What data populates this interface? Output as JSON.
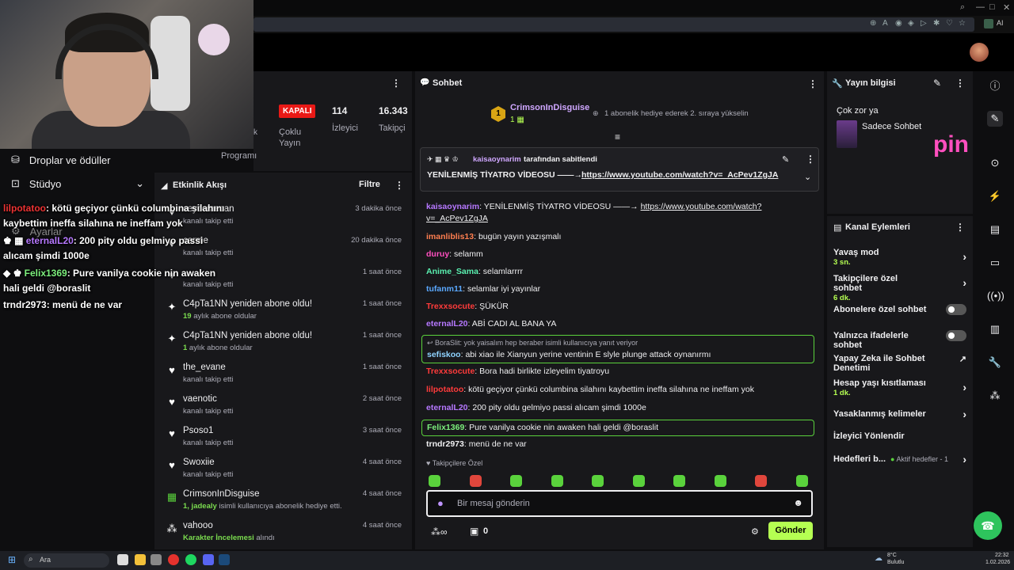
{
  "left_panel": {
    "drops": "Droplar ve ödüller",
    "studio": "Stüdyo",
    "settings": "Ayarlar"
  },
  "stats": {
    "status": "KAPALI",
    "viewers_value": "114",
    "viewers_label": "İzleyici",
    "followers_value": "16.343",
    "followers_label": "Takipçi",
    "multistream": "Çoklu\nYayın",
    "program": "Programı",
    "k": "k"
  },
  "activity": {
    "title": "Etkinlik Akışı",
    "filter": "Filtre",
    "rows": [
      {
        "icon": "heart",
        "name": "ceycemecan",
        "sub": "kanalı takip etti",
        "time": "3 dakika önce"
      },
      {
        "icon": "heart",
        "name": "carme",
        "sub": "kanalı takip etti",
        "time": "20 dakika önce"
      },
      {
        "icon": "heart",
        "name": "",
        "sub": "kanalı takip etti",
        "time": "1 saat önce"
      },
      {
        "icon": "sparkle",
        "name": "C4pTa1NN yeniden abone oldu!",
        "sub_g": "19",
        "sub": " aylık abone oldular",
        "time": "1 saat önce"
      },
      {
        "icon": "sparkle",
        "name": "C4pTa1NN yeniden abone oldu!",
        "sub_g": "1",
        "sub": " aylık abone oldular",
        "time": "1 saat önce"
      },
      {
        "icon": "heart",
        "name": "the_evane",
        "sub": "kanalı takip etti",
        "time": "1 saat önce"
      },
      {
        "icon": "heart",
        "name": "vaenotic",
        "sub": "kanalı takip etti",
        "time": "2 saat önce"
      },
      {
        "icon": "heart",
        "name": "Psoso1",
        "sub": "kanalı takip etti",
        "time": "3 saat önce"
      },
      {
        "icon": "heart",
        "name": "Swoxiie",
        "sub": "kanalı takip etti",
        "time": "4 saat önce"
      },
      {
        "icon": "gift",
        "name": "CrimsonInDisguise",
        "sub_g": "1, jadealy",
        "sub": " isimli kullanıcıya abonelik hediye etti.",
        "time": "4 saat önce"
      },
      {
        "icon": "bits",
        "name": "vahooo",
        "sub_g": "Karakter İncelemesi",
        "sub": " alındı",
        "time": "4 saat önce"
      }
    ]
  },
  "overlay": [
    {
      "user": "lilpotatoo",
      "text": ": kötü geçiyor çünkü columbina silahını kaybettim ineffa silahına ne ineffam yok",
      "color": "#e33"
    },
    {
      "user": "eternalL20",
      "text": ": 200 pity oldu gelmiyo passi alıcam şimdi 1000e",
      "color": "#b678ff"
    },
    {
      "user": "Felix1369",
      "text": ": Pure vanilya cookie nin awaken hali geldi @boraslit",
      "color": "#7df07d"
    },
    {
      "user": "trndr2973",
      "text": ": menü de ne var",
      "color": "#fff"
    }
  ],
  "chat": {
    "title": "Sohbet",
    "hype_user": "CrimsonInDisguise",
    "hype_count": "1",
    "hype_rank": "1",
    "hype_hint": "1 abonelik hediye ederek 2. sıraya yükselin",
    "pinned_by_user": "kaisaoynarim",
    "pinned_by_text": "tarafından sabitlendi",
    "pinned_msg": "YENİLENMİŞ TİYATRO VİDEOSU ——→",
    "pinned_link": "https://www.youtube.com/watch?v=_AcPev1ZgJA",
    "messages": [
      {
        "user": "kaisaoynarim",
        "color": "#b678ff",
        "text": ": YENİLENMİŞ TİYATRO VİDEOSU ——→ ",
        "link": "https://www.youtube.com/watch?",
        "link2": "v=_AcPev1ZgJA"
      },
      {
        "user": "imanliblis13",
        "color": "#ff7f50",
        "text": ": bugün yayın yazışmalı"
      },
      {
        "user": "duruy",
        "color": "#ff4fbf",
        "text": ": selamm"
      },
      {
        "user": "Anime_Sama",
        "color": "#5af0b0",
        "text": ": selamlarrrr"
      },
      {
        "user": "tufanm11",
        "color": "#5aa8ff",
        "text": ": selamlar iyi yayınlar"
      },
      {
        "user": "Trexxsocute",
        "color": "#ff3b3b",
        "text": ": ŞÜKÜR"
      },
      {
        "user": "eternalL20",
        "color": "#b678ff",
        "text": ": ABİ CADI AL BANA YA"
      },
      {
        "reply": "BoraSlit: yok yaisalım hep beraber isimli kullanıcıya yanıt veriyor",
        "user": "sefiskoo",
        "color": "#8fd3ff",
        "text": ": abi xiao ile Xianyun yerine ventinin E slyle plunge attack oynanırmı"
      },
      {
        "user": "Trexxsocute",
        "color": "#ff3b3b",
        "text": ": Bora hadi birlikte izleyelim tiyatroyu"
      },
      {
        "user": "lilpotatoo",
        "color": "#ff3b3b",
        "text": ": kötü geçiyor çünkü columbina silahını kaybettim ineffa silahına ne ineffam yok"
      },
      {
        "user": "eternalL20",
        "color": "#b678ff",
        "text": ": 200 pity oldu gelmiyo passi alıcam şimdi 1000e"
      },
      {
        "user": "Felix1369",
        "color": "#7df07d",
        "text": ": Pure vanilya cookie nin awaken hali geldi @boraslit"
      },
      {
        "user": "trndr2973",
        "color": "#efeff1",
        "text": ": menü de ne var"
      }
    ],
    "followers_only": "Takipçilere Özel",
    "placeholder": "Bir mesaj gönderin",
    "points": "0",
    "send": "Gönder"
  },
  "info": {
    "title": "Yayın bilgisi",
    "stream_title": "Çok zor ya",
    "category": "Sadece Sohbet",
    "brand_text": "pin"
  },
  "actions": {
    "title": "Kanal Eylemleri",
    "items": [
      {
        "label": "Yavaş mod",
        "sub": "3 sn.",
        "control": "chevron"
      },
      {
        "label": "Takipçilere özel sohbet",
        "sub": "6 dk.",
        "control": "chevron"
      },
      {
        "label": "Abonelere özel sohbet",
        "sub": "",
        "control": "toggle"
      },
      {
        "label": "Yalnızca ifadelerle sohbet",
        "sub": "",
        "control": "toggle"
      },
      {
        "label": "Yapay Zeka ile Sohbet Denetimi",
        "sub": "",
        "control": "external"
      },
      {
        "label": "Hesap yaşı kısıtlaması",
        "sub": "1 dk.",
        "control": "chevron"
      },
      {
        "label": "Yasaklanmış kelimeler",
        "sub": "",
        "control": "chevron"
      },
      {
        "label": "İzleyici Yönlendir",
        "sub": "",
        "control": "none"
      },
      {
        "label": "Hedefleri b...",
        "sub": "",
        "control": "chevron",
        "extra": "Aktif hedefler - 1"
      }
    ]
  },
  "taskbar": {
    "search": "Ara",
    "weather_temp": "8°C",
    "weather_desc": "Bulutlu",
    "time": "22:32",
    "date": "1.02.2026"
  },
  "colors": {
    "accent": "#b5ff52",
    "live_off": "#e91916",
    "panel": "#18181b",
    "bg": "#0e0e10"
  }
}
